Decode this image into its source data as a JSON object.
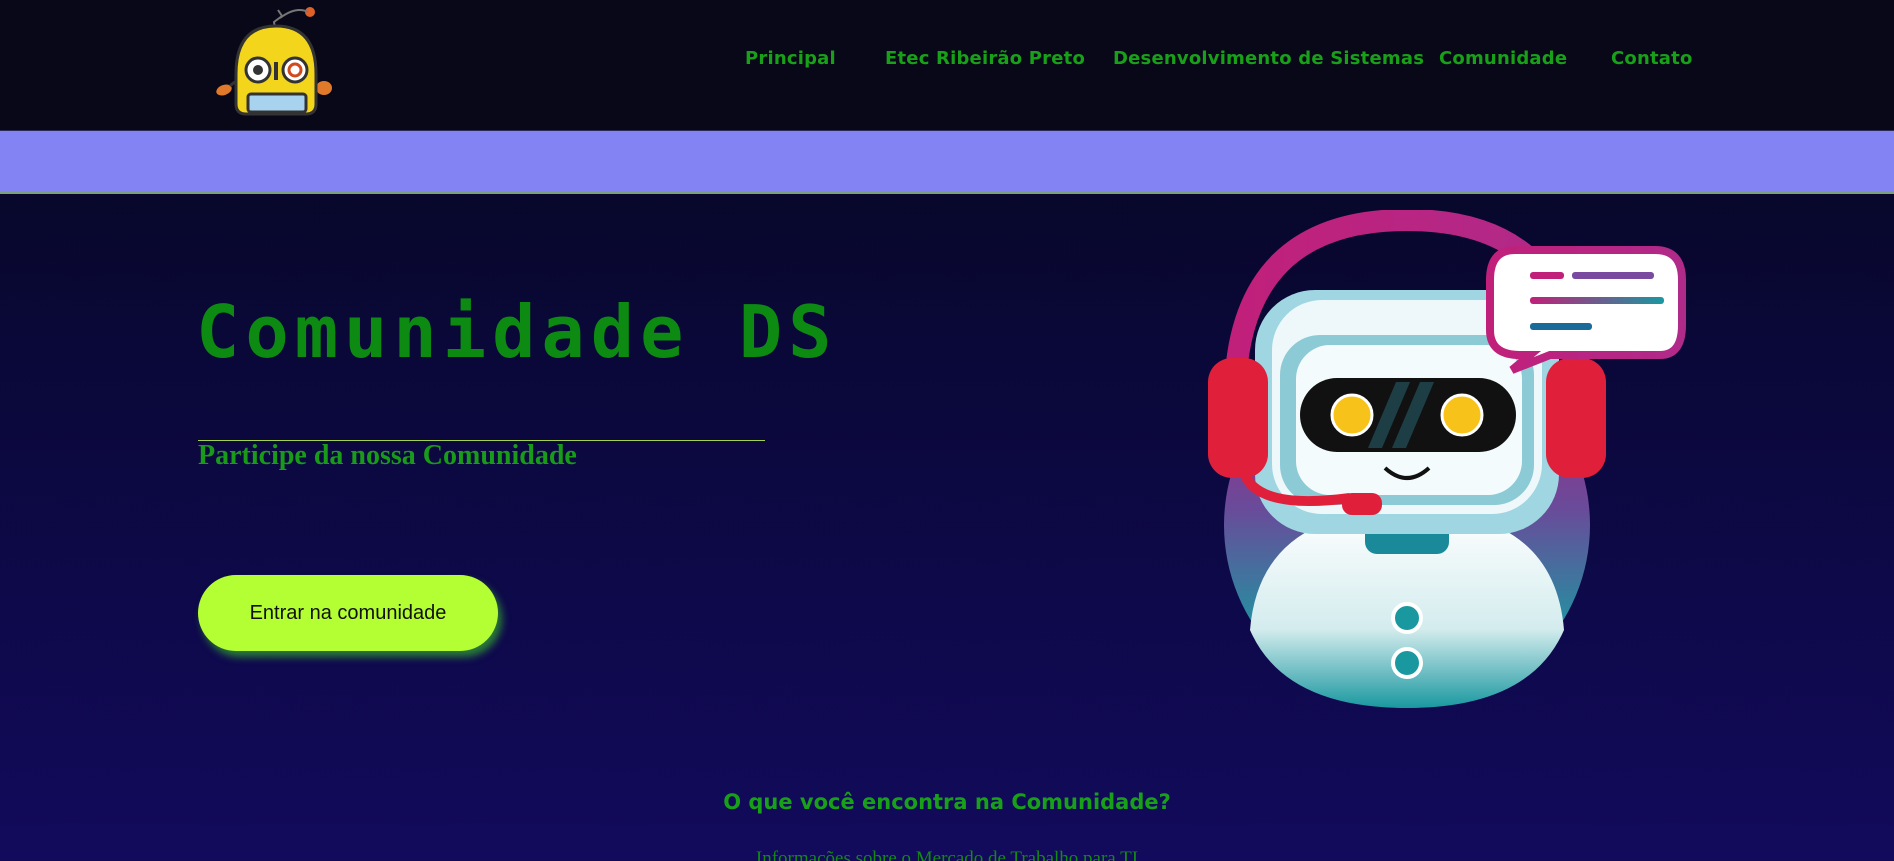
{
  "nav": {
    "items": [
      {
        "label": "Principal"
      },
      {
        "label": "Etec Ribeirão Preto"
      },
      {
        "label": "Desenvolvimento de Sistemas"
      },
      {
        "label": "Comunidade"
      },
      {
        "label": "Contato"
      }
    ]
  },
  "hero": {
    "title": "Comunidade DS",
    "subtitle": "Participe da nossa Comunidade",
    "cta_label": "Entrar na comunidade"
  },
  "section": {
    "title": "O que você encontra na Comunidade?",
    "first_item": "Informações sobre o Mercado de Trabalho para TI"
  },
  "colors": {
    "nav_text": "#19a019",
    "band": "#8383f3",
    "cta": "#b3ff33",
    "headline": "#0c8a12"
  },
  "icons": {
    "logo": "yellow-robot-logo-icon",
    "illustration": "support-robot-headset-illustration"
  }
}
